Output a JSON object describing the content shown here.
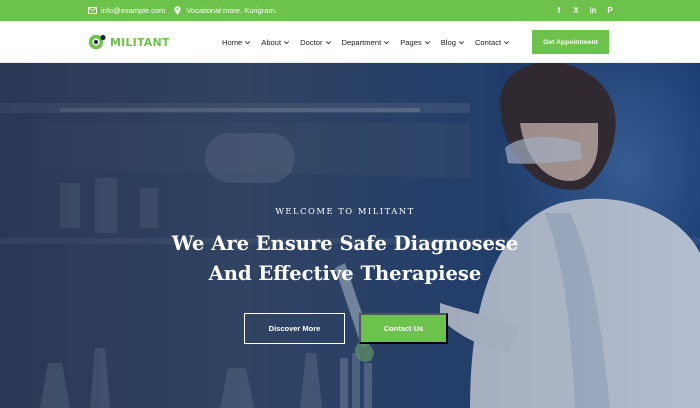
{
  "topbar": {
    "email": "info@example.com",
    "address": "Vocational more, Kurigram.",
    "social": [
      {
        "icon": "facebook-icon",
        "glyph": "f"
      },
      {
        "icon": "x-twitter-icon",
        "glyph": "X"
      },
      {
        "icon": "linkedin-icon",
        "glyph": "in"
      },
      {
        "icon": "pinterest-icon",
        "glyph": "P"
      }
    ]
  },
  "header": {
    "logo_text": "MILITANT",
    "nav": [
      {
        "label": "Home"
      },
      {
        "label": "About"
      },
      {
        "label": "Doctor"
      },
      {
        "label": "Department"
      },
      {
        "label": "Pages"
      },
      {
        "label": "Blog"
      },
      {
        "label": "Contact"
      }
    ],
    "cta_label": "Get Appointment"
  },
  "hero": {
    "eyebrow": "WELCOME TO MILITANT",
    "headline_line1": "We Are Ensure Safe Diagnosese",
    "headline_line2": "And Effective Therapiese",
    "primary_button": "Discover More",
    "secondary_button": "Contact Us"
  },
  "colors": {
    "accent": "#6cc24a",
    "hero_overlay": "#2a4a7a",
    "text_dark": "#222222"
  }
}
